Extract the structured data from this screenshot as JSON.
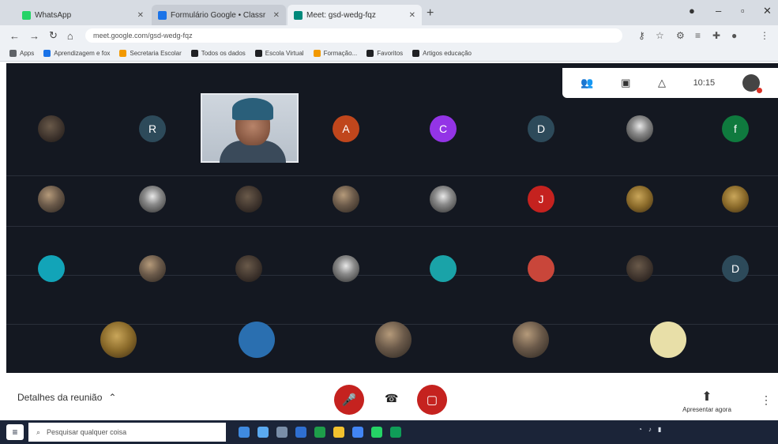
{
  "browser": {
    "tabs": [
      {
        "label": "WhatsApp",
        "color": "#25d366"
      },
      {
        "label": "Formulário Google • Classr",
        "color": "#1a73e8"
      },
      {
        "label": "Meet: gsd-wedg-fqz",
        "color": "#00897b"
      }
    ],
    "new_tab_icon": "plus-icon",
    "url": "meet.google.com/gsd-wedg-fqz",
    "bookmarks": [
      "Apps",
      "Aprendizagem e fox",
      "Secretaria Escolar",
      "Todos os dados",
      "Escola Virtual",
      "Formação...",
      "Favoritos",
      "Artigos educação"
    ]
  },
  "meeting": {
    "clock": "10:15",
    "topbar_icons": [
      "people-icon",
      "chat-icon",
      "activities-icon"
    ],
    "participants": [
      {
        "initial": "",
        "kind": "dim"
      },
      {
        "initial": "R",
        "color": "#2d4a5a"
      },
      {
        "initial": "A",
        "color": "#c0461c"
      },
      {
        "initial": "C",
        "color": "#9334e6"
      },
      {
        "initial": "D",
        "color": "#2d4a5a"
      },
      {
        "initial": "",
        "kind": "photo2"
      },
      {
        "initial": "f",
        "color": "#0f7a3e"
      },
      {
        "initial": "",
        "kind": "photo"
      },
      {
        "initial": "",
        "kind": "photo2"
      },
      {
        "initial": "",
        "kind": "dim"
      },
      {
        "initial": "",
        "kind": "photo"
      },
      {
        "initial": "",
        "kind": "photo2"
      },
      {
        "initial": "J",
        "color": "#c5221f"
      },
      {
        "initial": "",
        "kind": "photo3"
      },
      {
        "initial": "",
        "kind": "photo3"
      },
      {
        "initial": "",
        "color": "#12a4b8"
      },
      {
        "initial": "",
        "kind": "photo"
      },
      {
        "initial": "",
        "kind": "dim"
      },
      {
        "initial": "",
        "kind": "photo2"
      },
      {
        "initial": "",
        "color": "#1aa3a8"
      },
      {
        "initial": "",
        "color": "#c9463a"
      },
      {
        "initial": "",
        "kind": "dim"
      },
      {
        "initial": "D",
        "color": "#2d4a5a"
      },
      {
        "initial": "",
        "kind": "photo3"
      },
      {
        "initial": "",
        "color": "#2a6fb0"
      },
      {
        "initial": "",
        "kind": "photo"
      },
      {
        "initial": "",
        "kind": "photo"
      },
      {
        "initial": "",
        "color": "#e8dfa8"
      }
    ]
  },
  "controls": {
    "details_label": "Detalhes da reunião",
    "mic_icon": "mic-off-icon",
    "cam_icon": "camera-off-icon",
    "leave_icon": "hang-up-icon",
    "present_label": "Apresentar agora",
    "mic_color": "#c5221f"
  },
  "taskbar": {
    "search_placeholder": "Pesquisar qualquer coisa"
  }
}
